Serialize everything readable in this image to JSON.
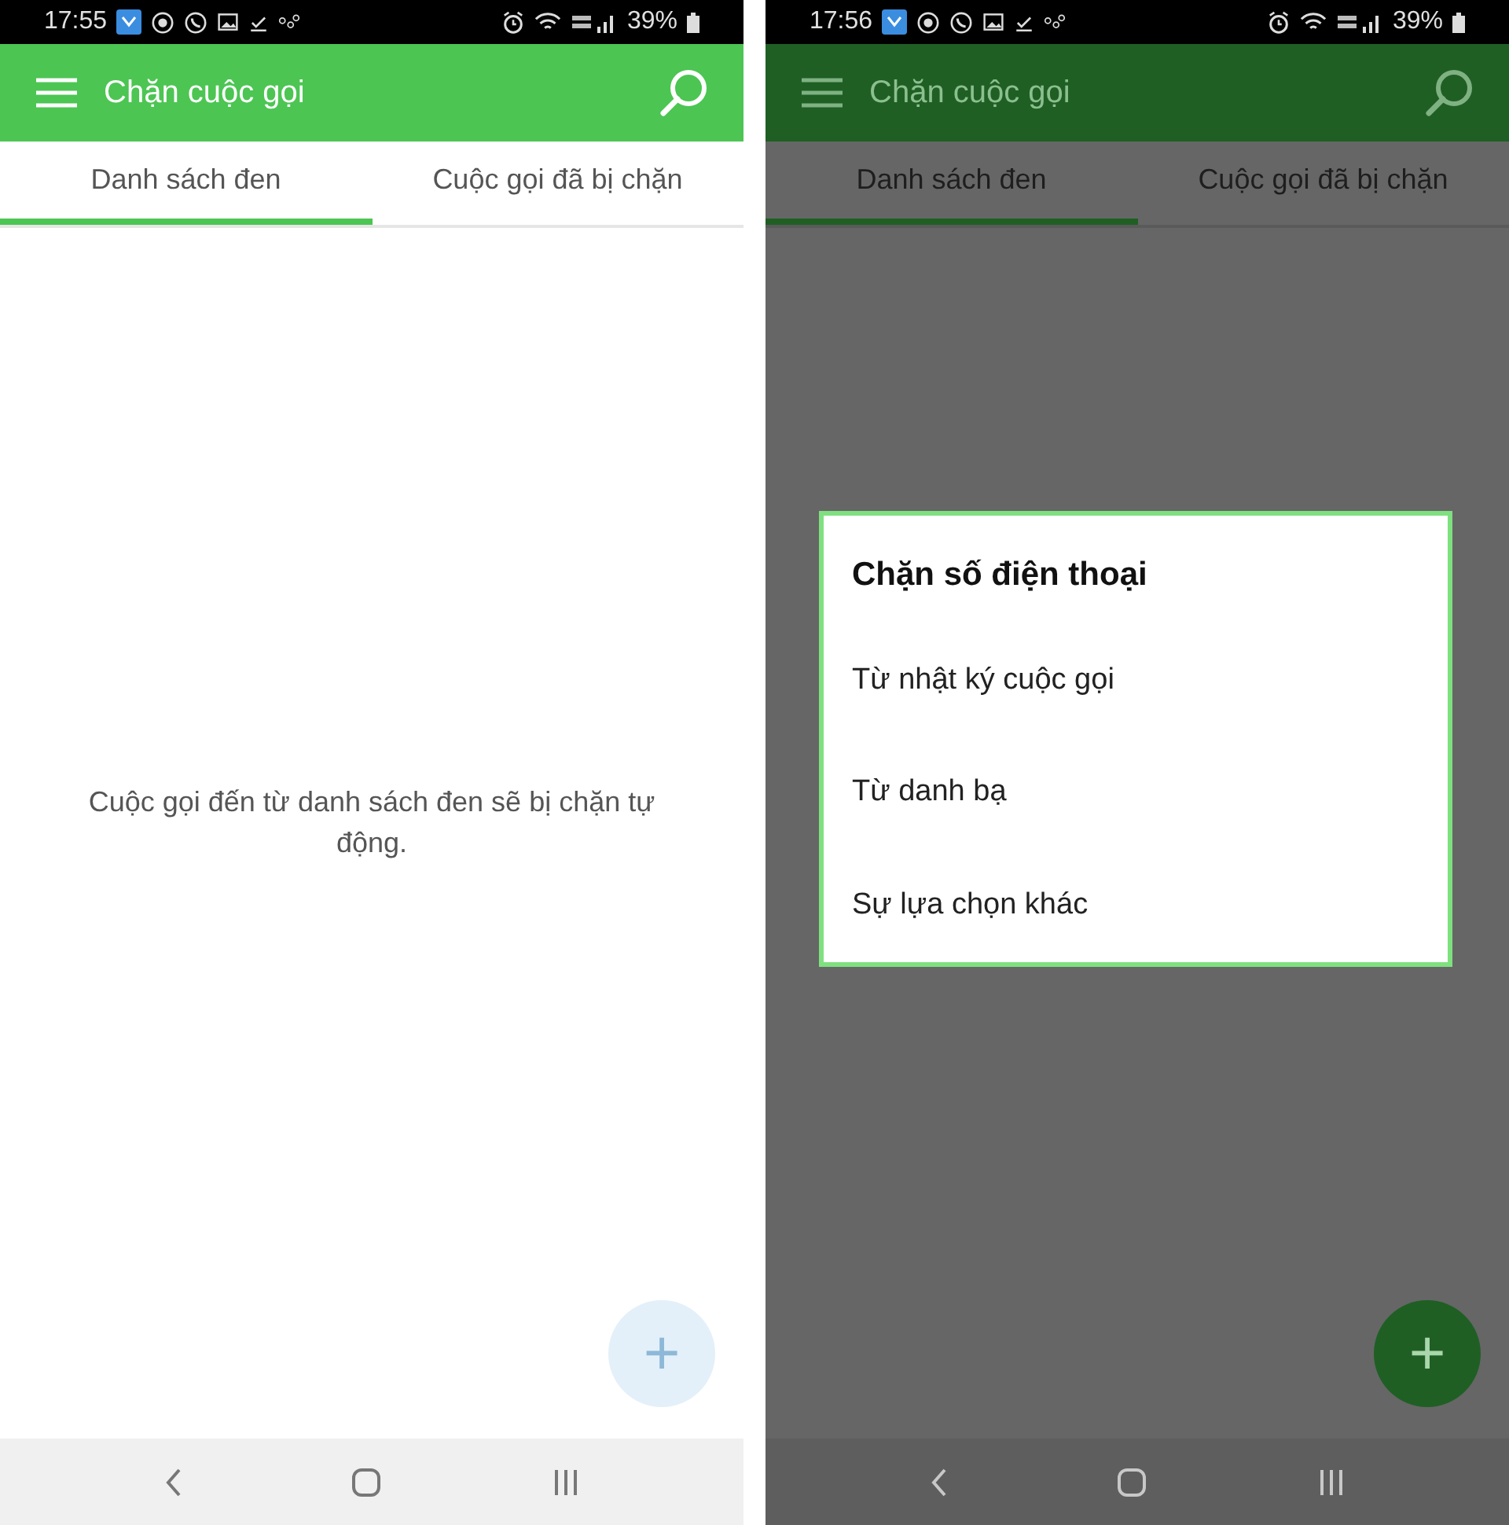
{
  "screens": [
    {
      "status_bar": {
        "time": "17:55",
        "battery": "39%"
      },
      "app_bar": {
        "title": "Chặn cuộc gọi"
      },
      "dimmed": false,
      "tabs": [
        {
          "label": "Danh sách đen",
          "selected": true
        },
        {
          "label": "Cuộc gọi đã bị chặn",
          "selected": false
        }
      ],
      "empty_message": "Cuộc gọi đến từ danh sách đen sẽ bị chặn tự động.",
      "fab": {
        "label": "+",
        "faded": true
      }
    },
    {
      "status_bar": {
        "time": "17:56",
        "battery": "39%"
      },
      "app_bar": {
        "title": "Chặn cuộc gọi"
      },
      "dimmed": true,
      "tabs": [
        {
          "label": "Danh sách đen",
          "selected": true
        },
        {
          "label": "Cuộc gọi đã bị chặn",
          "selected": false
        }
      ],
      "fab": {
        "label": "+",
        "faded": false
      },
      "dialog": {
        "title": "Chặn số điện thoại",
        "options": [
          "Từ nhật ký cuộc gọi",
          "Từ danh bạ",
          "Sự lựa chọn khác"
        ]
      }
    }
  ]
}
